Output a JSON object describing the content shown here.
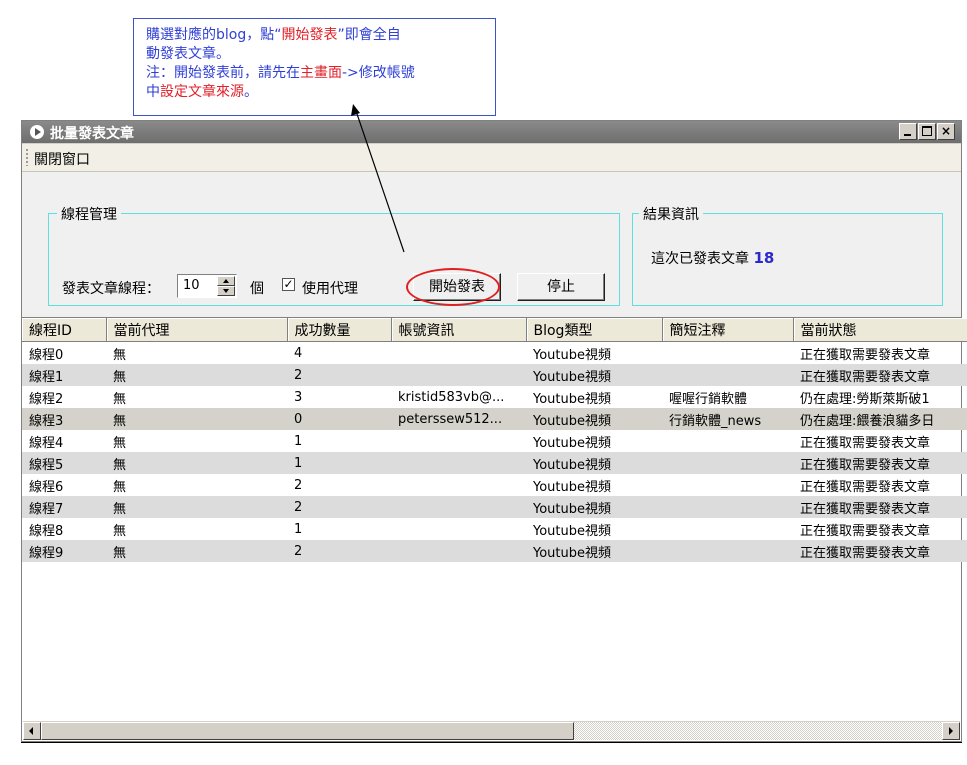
{
  "annotation": {
    "line1_a": "購選對應的blog，點“",
    "line1_b": "開始發表",
    "line1_c": "”即會全自",
    "line2": "動發表文章。",
    "line3_a": "注：開始發表前，請先在",
    "line3_b": "主畫面",
    "line3_c": "->修改帳號",
    "line4_a": "中",
    "line4_b": "設定文章來源",
    "line4_c": "。"
  },
  "window": {
    "title": "批量發表文章",
    "close_glyph": "×"
  },
  "menu": {
    "close_window": "關閉窗口"
  },
  "thread_group": {
    "legend": "線程管理",
    "threads_label": "發表文章線程：",
    "threads_value": "10",
    "unit": "個",
    "check_glyph": "✓",
    "proxy_label": "使用代理",
    "start_label": "開始發表",
    "stop_label": "停止"
  },
  "result_group": {
    "legend": "結果資訊",
    "published_label": "這次已發表文章",
    "published_count": "18"
  },
  "colors": {
    "accent_blue": "#2f3fd6",
    "highlight_red": "#e0202a",
    "group_border": "#5fe0e0"
  },
  "table": {
    "columns": [
      "線程ID",
      "當前代理",
      "成功數量",
      "帳號資訊",
      "Blog類型",
      "簡短注釋",
      "當前狀態"
    ],
    "rows": [
      [
        "線程0",
        "無",
        "4",
        "",
        "Youtube視頻",
        "",
        "正在獲取需要發表文章"
      ],
      [
        "線程1",
        "無",
        "2",
        "",
        "Youtube視頻",
        "",
        "正在獲取需要發表文章"
      ],
      [
        "線程2",
        "無",
        "3",
        "kristid583vb@...",
        "Youtube視頻",
        "喔喔行銷軟體",
        "仍在處理:勞斯萊斯破1"
      ],
      [
        "線程3",
        "無",
        "0",
        "peterssew512...",
        "Youtube視頻",
        "行銷軟體_news",
        "仍在處理:餵養浪貓多日"
      ],
      [
        "線程4",
        "無",
        "1",
        "",
        "Youtube視頻",
        "",
        "正在獲取需要發表文章"
      ],
      [
        "線程5",
        "無",
        "1",
        "",
        "Youtube視頻",
        "",
        "正在獲取需要發表文章"
      ],
      [
        "線程6",
        "無",
        "2",
        "",
        "Youtube視頻",
        "",
        "正在獲取需要發表文章"
      ],
      [
        "線程7",
        "無",
        "2",
        "",
        "Youtube視頻",
        "",
        "正在獲取需要發表文章"
      ],
      [
        "線程8",
        "無",
        "1",
        "",
        "Youtube視頻",
        "",
        "正在獲取需要發表文章"
      ],
      [
        "線程9",
        "無",
        "2",
        "",
        "Youtube視頻",
        "",
        "正在獲取需要發表文章"
      ]
    ]
  }
}
